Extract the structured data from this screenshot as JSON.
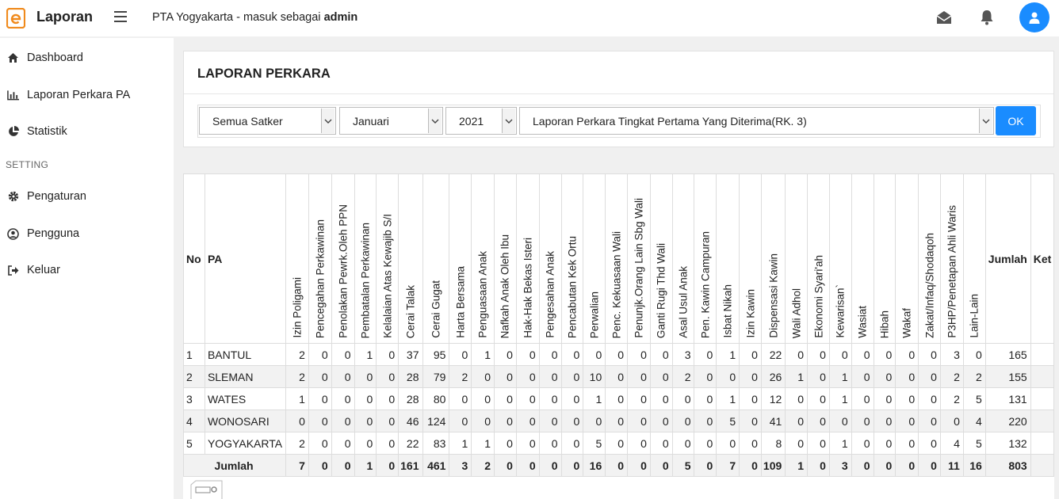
{
  "header": {
    "app_title": "Laporan",
    "context_prefix": "PTA Yogyakarta - masuk sebagai ",
    "user": "admin",
    "accent": "#1a8cff",
    "logo_color": "#f08a1c"
  },
  "sidebar": {
    "items": [
      {
        "label": "Dashboard",
        "icon": "home-icon"
      },
      {
        "label": "Laporan Perkara PA",
        "icon": "bar-chart-icon"
      },
      {
        "label": "Statistik",
        "icon": "pie-chart-icon"
      }
    ],
    "section": "SETTING",
    "settings": [
      {
        "label": "Pengaturan",
        "icon": "gear-icon"
      },
      {
        "label": "Pengguna",
        "icon": "user-circle-icon"
      },
      {
        "label": "Keluar",
        "icon": "sign-out-icon"
      }
    ]
  },
  "report": {
    "title": "LAPORAN PERKARA",
    "filters": {
      "satker": "Semua Satker",
      "bulan": "Januari",
      "tahun": "2021",
      "jenis": "Laporan Perkara Tingkat Pertama Yang Diterima(RK. 3)",
      "ok_label": "OK"
    }
  },
  "table": {
    "col_no": "No",
    "col_pa": "PA",
    "columns": [
      "Izin Poligami",
      "Pencegahan Perkawinan",
      "Penolakan Pewrk.Oleh PPN",
      "Pembatalan Perkawinan",
      "Kelalaian Atas Kewajib S/I",
      "Cerai Talak",
      "Cerai Gugat",
      "Harta Bersama",
      "Penguasaan Anak",
      "Nafkah Anak Oleh Ibu",
      "Hak-Hak Bekas Isteri",
      "Pengesahan Anak",
      "Pencabutan Kek Ortu",
      "Perwalian",
      "Penc. Kekuasaan Wali",
      "Penunjk.Orang Lain Sbg Wali",
      "Ganti Rugi Thd Wali",
      "Asal Usul Anak",
      "Pen. Kawin Campuran",
      "Isbat Nikah",
      "Izin Kawin",
      "Dispensasi Kawin",
      "Wali Adhol",
      "Ekonomi Syari'ah",
      "Kewarisan`",
      "Wasiat",
      "Hibah",
      "Wakaf",
      "Zakat/Infaq/Shodaqoh",
      "P3HP/Penetapan Ahli Waris",
      "Lain-Lain"
    ],
    "col_jumlah": "Jumlah",
    "col_ket": "Ket",
    "rows": [
      {
        "no": "1",
        "pa": "BANTUL",
        "values": [
          "2",
          "0",
          "0",
          "1",
          "0",
          "37",
          "95",
          "0",
          "1",
          "0",
          "0",
          "0",
          "0",
          "0",
          "0",
          "0",
          "0",
          "3",
          "0",
          "1",
          "0",
          "22",
          "0",
          "0",
          "0",
          "0",
          "0",
          "0",
          "0",
          "3",
          "0"
        ],
        "jumlah": "165",
        "ket": ""
      },
      {
        "no": "2",
        "pa": "SLEMAN",
        "values": [
          "2",
          "0",
          "0",
          "0",
          "0",
          "28",
          "79",
          "2",
          "0",
          "0",
          "0",
          "0",
          "0",
          "10",
          "0",
          "0",
          "0",
          "2",
          "0",
          "0",
          "0",
          "26",
          "1",
          "0",
          "1",
          "0",
          "0",
          "0",
          "0",
          "2",
          "2"
        ],
        "jumlah": "155",
        "ket": ""
      },
      {
        "no": "3",
        "pa": "WATES",
        "values": [
          "1",
          "0",
          "0",
          "0",
          "0",
          "28",
          "80",
          "0",
          "0",
          "0",
          "0",
          "0",
          "0",
          "1",
          "0",
          "0",
          "0",
          "0",
          "0",
          "1",
          "0",
          "12",
          "0",
          "0",
          "1",
          "0",
          "0",
          "0",
          "0",
          "2",
          "5"
        ],
        "jumlah": "131",
        "ket": ""
      },
      {
        "no": "4",
        "pa": "WONOSARI",
        "values": [
          "0",
          "0",
          "0",
          "0",
          "0",
          "46",
          "124",
          "0",
          "0",
          "0",
          "0",
          "0",
          "0",
          "0",
          "0",
          "0",
          "0",
          "0",
          "0",
          "5",
          "0",
          "41",
          "0",
          "0",
          "0",
          "0",
          "0",
          "0",
          "0",
          "0",
          "4"
        ],
        "jumlah": "220",
        "ket": ""
      },
      {
        "no": "5",
        "pa": "YOGYAKARTA",
        "values": [
          "2",
          "0",
          "0",
          "0",
          "0",
          "22",
          "83",
          "1",
          "1",
          "0",
          "0",
          "0",
          "0",
          "5",
          "0",
          "0",
          "0",
          "0",
          "0",
          "0",
          "0",
          "8",
          "0",
          "0",
          "1",
          "0",
          "0",
          "0",
          "0",
          "4",
          "5"
        ],
        "jumlah": "132",
        "ket": ""
      }
    ],
    "total": {
      "label": "Jumlah",
      "values": [
        "7",
        "0",
        "0",
        "1",
        "0",
        "161",
        "461",
        "3",
        "2",
        "0",
        "0",
        "0",
        "0",
        "16",
        "0",
        "0",
        "0",
        "5",
        "0",
        "7",
        "0",
        "109",
        "1",
        "0",
        "3",
        "0",
        "0",
        "0",
        "0",
        "11",
        "16"
      ],
      "jumlah": "803"
    }
  }
}
